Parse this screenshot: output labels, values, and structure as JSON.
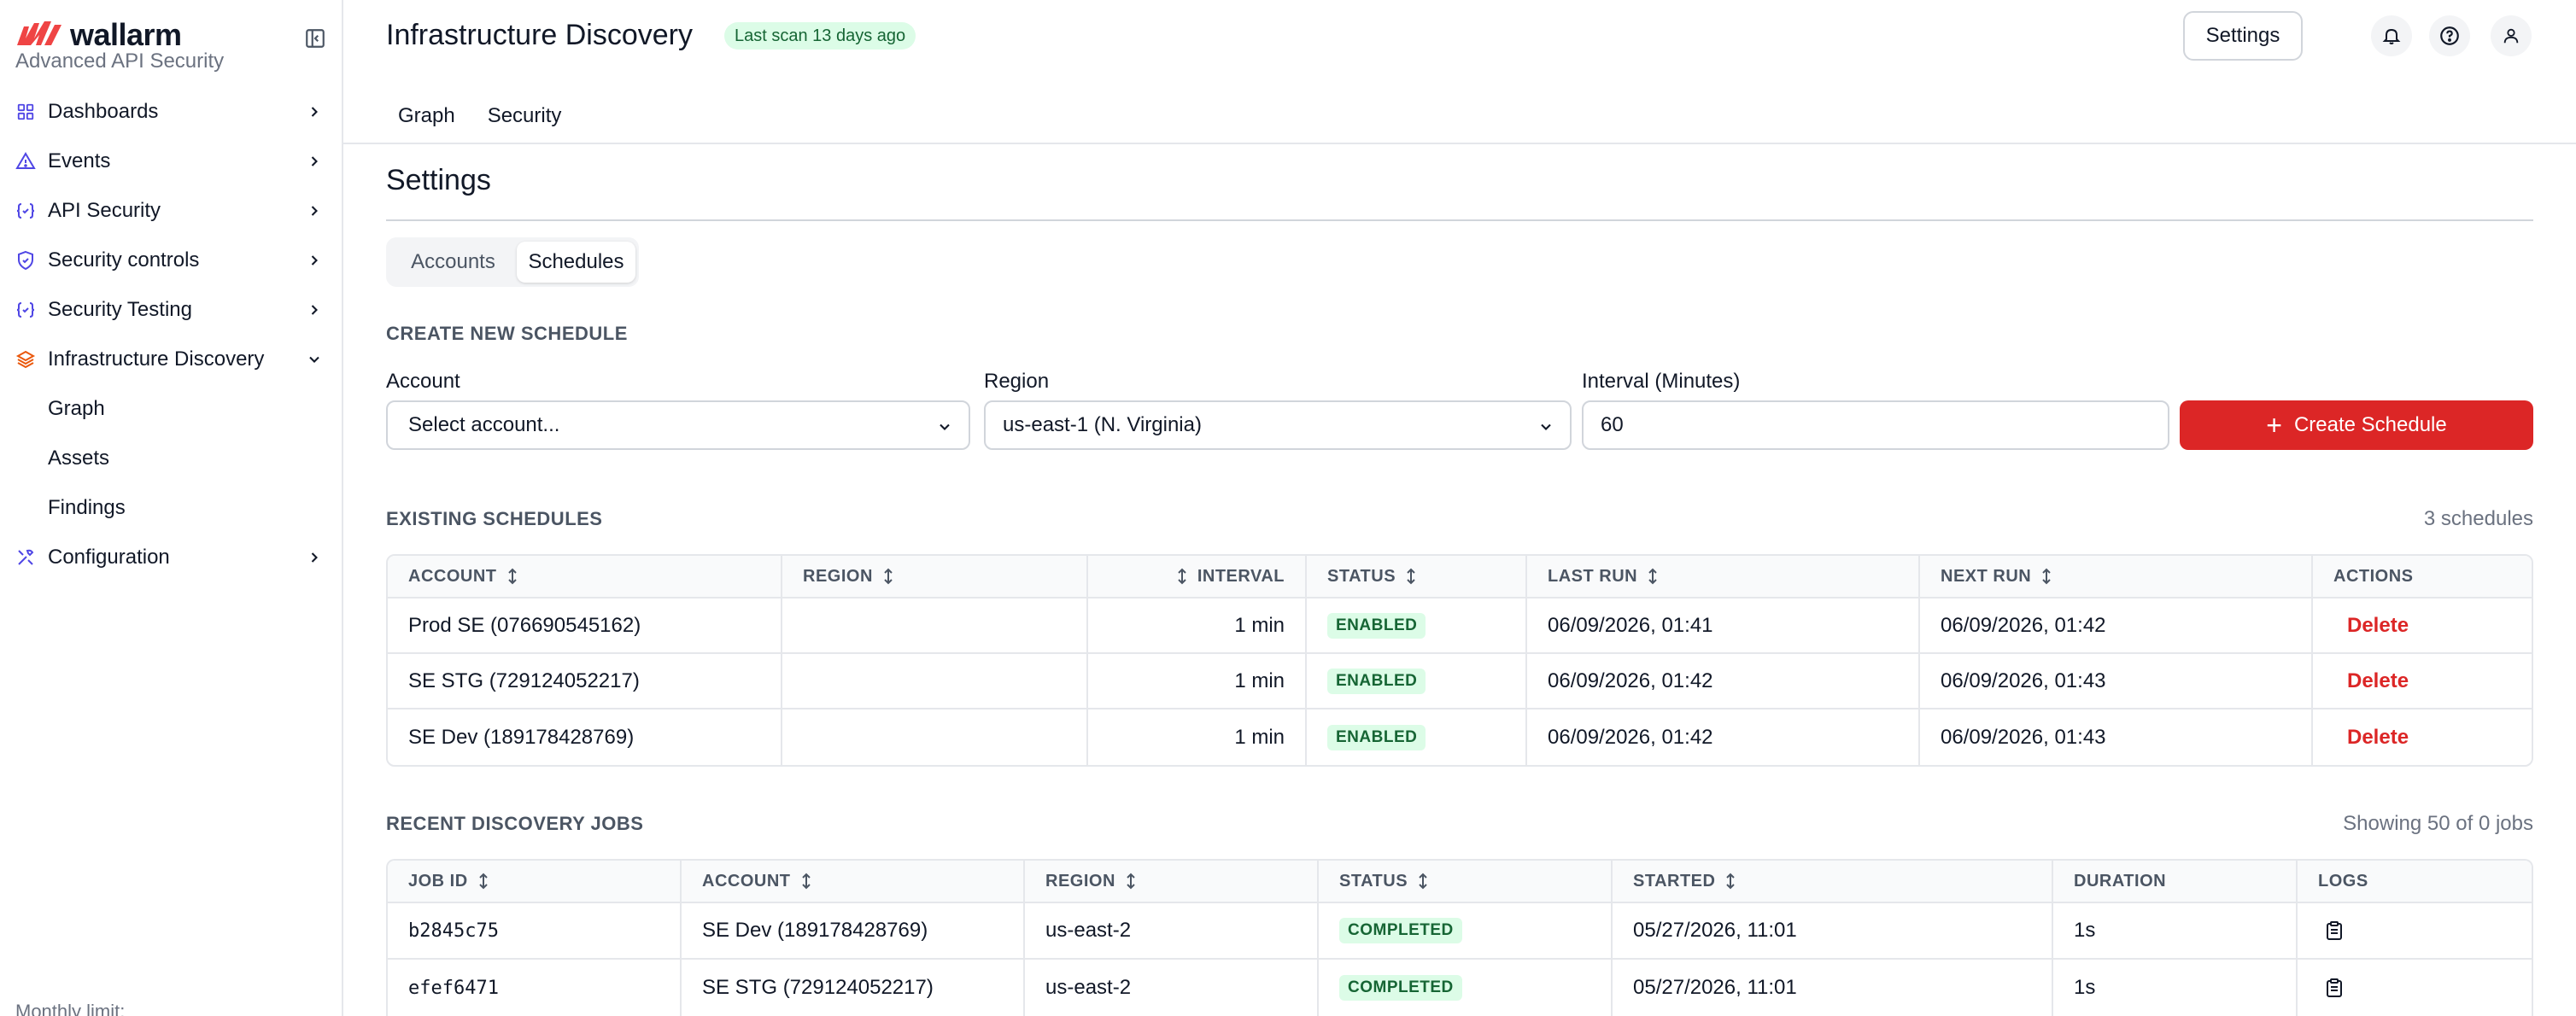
{
  "brand": {
    "name": "wallarm",
    "subtitle": "Advanced API Security"
  },
  "sidebar": {
    "items": [
      {
        "label": "Dashboards",
        "icon": "grid-icon"
      },
      {
        "label": "Events",
        "icon": "warning-triangle-icon"
      },
      {
        "label": "API Security",
        "icon": "api-brackets-icon"
      },
      {
        "label": "Security controls",
        "icon": "shield-icon"
      },
      {
        "label": "Security Testing",
        "icon": "api-brackets-icon"
      },
      {
        "label": "Infrastructure Discovery",
        "icon": "layers-icon",
        "expanded": true
      },
      {
        "label": "Configuration",
        "icon": "tools-icon"
      }
    ],
    "subitems": [
      "Graph",
      "Assets",
      "Findings"
    ],
    "monthly_limit": "Monthly limit:"
  },
  "header": {
    "title": "Infrastructure Discovery",
    "scan_badge": "Last scan 13 days ago",
    "settings_label": "Settings",
    "tabs": [
      "Graph",
      "Security"
    ]
  },
  "settings": {
    "title": "Settings",
    "segments": [
      "Accounts",
      "Schedules"
    ],
    "active_segment": "Schedules"
  },
  "create": {
    "heading": "CREATE NEW SCHEDULE",
    "account_label": "Account",
    "account_value": "Select account...",
    "region_label": "Region",
    "region_value": "us-east-1 (N. Virginia)",
    "interval_label": "Interval (Minutes)",
    "interval_value": "60",
    "button": "Create Schedule"
  },
  "schedules": {
    "heading": "EXISTING SCHEDULES",
    "count": "3 schedules",
    "columns": [
      "ACCOUNT",
      "REGION",
      "INTERVAL",
      "STATUS",
      "LAST RUN",
      "NEXT RUN",
      "ACTIONS"
    ],
    "rows": [
      {
        "account": "Prod SE (076690545162)",
        "region": "",
        "interval": "1 min",
        "status": "ENABLED",
        "last_run": "06/09/2026, 01:41",
        "next_run": "06/09/2026, 01:42",
        "action": "Delete"
      },
      {
        "account": "SE STG (729124052217)",
        "region": "",
        "interval": "1 min",
        "status": "ENABLED",
        "last_run": "06/09/2026, 01:42",
        "next_run": "06/09/2026, 01:43",
        "action": "Delete"
      },
      {
        "account": "SE Dev (189178428769)",
        "region": "",
        "interval": "1 min",
        "status": "ENABLED",
        "last_run": "06/09/2026, 01:42",
        "next_run": "06/09/2026, 01:43",
        "action": "Delete"
      }
    ]
  },
  "jobs": {
    "heading": "RECENT DISCOVERY JOBS",
    "count": "Showing 50 of 0 jobs",
    "columns": [
      "JOB ID",
      "ACCOUNT",
      "REGION",
      "STATUS",
      "STARTED",
      "DURATION",
      "LOGS"
    ],
    "rows": [
      {
        "job_id": "b2845c75",
        "account": "SE Dev (189178428769)",
        "region": "us-east-2",
        "status": "COMPLETED",
        "started": "05/27/2026, 11:01",
        "duration": "1s"
      },
      {
        "job_id": "efef6471",
        "account": "SE STG (729124052217)",
        "region": "us-east-2",
        "status": "COMPLETED",
        "started": "05/27/2026, 11:01",
        "duration": "1s"
      }
    ]
  },
  "colors": {
    "accent": "#dc2626",
    "success_bg": "#dcfce7",
    "success_text": "#166534",
    "border": "#e5e7eb"
  }
}
